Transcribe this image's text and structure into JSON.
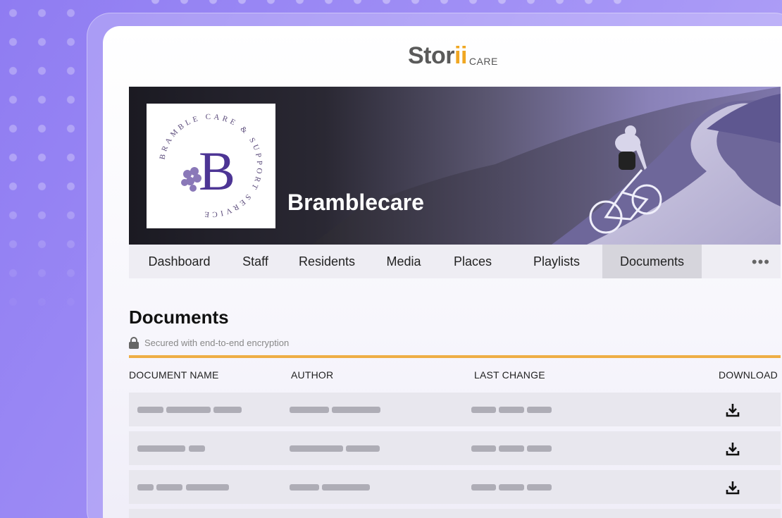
{
  "brand": {
    "word": "Stor",
    "accent": "ii",
    "suffix": "CARE"
  },
  "org": {
    "name": "Bramblecare",
    "logo_letter": "B",
    "logo_ring_text": "BRAMBLE CARE & SUPPORT SERVICE"
  },
  "nav": {
    "items": [
      "Dashboard",
      "Staff",
      "Residents",
      "Media",
      "Places",
      "Playlists",
      "Documents"
    ],
    "active": "Documents",
    "more": "•••"
  },
  "documents": {
    "title": "Documents",
    "secure_text": "Secured with end-to-end encryption",
    "columns": {
      "name": "DOCUMENT NAME",
      "author": "AUTHOR",
      "last_change": "LAST CHANGE",
      "download": "DOWNLOAD"
    }
  },
  "colors": {
    "accent": "#f0a722",
    "orange_line": "#eeae45",
    "purple": "#5c3f9e"
  }
}
